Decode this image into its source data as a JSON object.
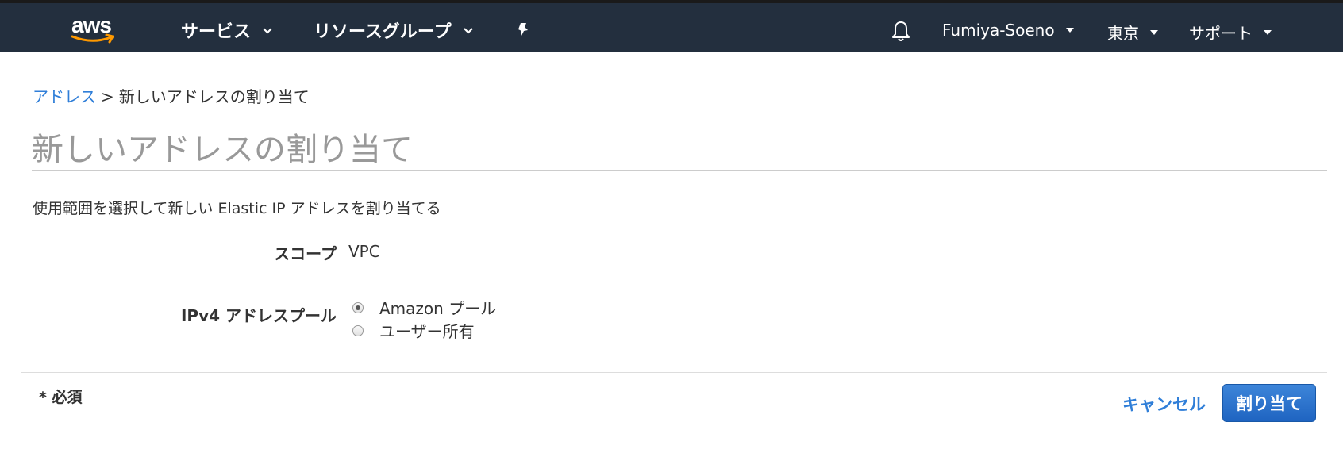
{
  "header": {
    "logo_text": "aws",
    "services_label": "サービス",
    "resource_groups_label": "リソースグループ",
    "user_label": "Fumiya-Soeno",
    "region_label": "東京",
    "support_label": "サポート"
  },
  "breadcrumb": {
    "parent": "アドレス",
    "separator": ">",
    "current": "新しいアドレスの割り当て"
  },
  "page": {
    "title": "新しいアドレスの割り当て",
    "description": "使用範囲を選択して新しい Elastic IP アドレスを割り当てる"
  },
  "form": {
    "scope_label": "スコープ",
    "scope_value": "VPC",
    "pool_label": "IPv4 アドレスプール",
    "pool_options": [
      {
        "label": "Amazon プール",
        "selected": true
      },
      {
        "label": "ユーザー所有",
        "selected": false
      }
    ]
  },
  "footer": {
    "required_note": "* 必須",
    "cancel_label": "キャンセル",
    "assign_label": "割り当て"
  },
  "colors": {
    "topbar": "#232f3e",
    "link": "#2f7ed8",
    "primary_button": "#2a72cf",
    "logo_smile": "#ff9900"
  }
}
